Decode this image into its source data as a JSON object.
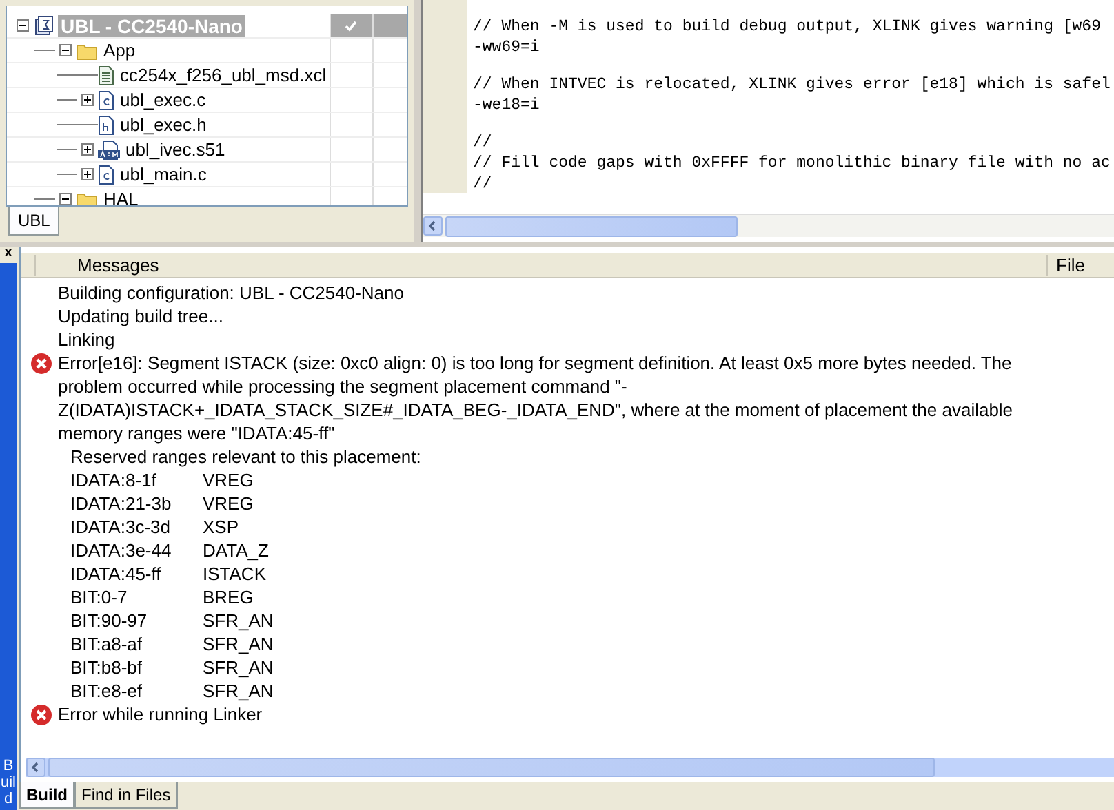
{
  "workspace": {
    "tree": [
      {
        "label": "UBL - CC2540-Nano",
        "kind": "project",
        "selected": true,
        "checked": true,
        "expanded": true,
        "children": [
          {
            "label": "App",
            "kind": "folder",
            "selected": false,
            "checked": false,
            "expanded": true,
            "children": [
              {
                "label": "cc254x_f256_ubl_msd.xcl",
                "kind": "text-file",
                "selected": false,
                "checked": false
              },
              {
                "label": "ubl_exec.c",
                "kind": "c-file",
                "selected": false,
                "checked": false,
                "expanded": false
              },
              {
                "label": "ubl_exec.h",
                "kind": "h-file",
                "selected": false,
                "checked": false
              },
              {
                "label": "ubl_ivec.s51",
                "kind": "asm-file",
                "selected": false,
                "checked": false,
                "expanded": false
              },
              {
                "label": "ubl_main.c",
                "kind": "c-file",
                "selected": false,
                "checked": false,
                "expanded": false
              }
            ]
          },
          {
            "label": "HAL",
            "kind": "folder",
            "selected": false,
            "checked": false,
            "expanded": true
          }
        ]
      }
    ],
    "tabs": [
      {
        "label": "UBL",
        "selected": true
      }
    ]
  },
  "editor": {
    "blocks": [
      [
        "// When -M is used to build debug output, XLINK gives warning [w69",
        "-ww69=i"
      ],
      [
        "// When INTVEC is relocated, XLINK gives error [e18] which is safel",
        "-we18=i"
      ],
      [
        "//",
        "// Fill code gaps with 0xFFFF for monolithic binary file with no ac",
        "//"
      ]
    ]
  },
  "build": {
    "side_label": "Build",
    "close": "x",
    "columns": [
      "Messages",
      "File"
    ],
    "messages": [
      {
        "kind": "info",
        "text": "Building configuration: UBL - CC2540-Nano"
      },
      {
        "kind": "info",
        "text": "Updating build tree..."
      },
      {
        "kind": "info",
        "text": "Linking"
      },
      {
        "kind": "error",
        "text": "Error[e16]: Segment ISTACK (size: 0xc0 align: 0) is too long for segment definition. At least 0x5 more bytes needed. The problem occurred while processing the segment placement command \"-Z(IDATA)ISTACK+_IDATA_STACK_SIZE#_IDATA_BEG-_IDATA_END\", where at the moment of placement the available memory ranges were \"IDATA:45-ff\""
      },
      {
        "kind": "detail",
        "text": "Reserved ranges relevant to this placement:"
      },
      {
        "kind": "range",
        "range": "IDATA:8-1f",
        "owner": "VREG"
      },
      {
        "kind": "range",
        "range": "IDATA:21-3b",
        "owner": "VREG"
      },
      {
        "kind": "range",
        "range": "IDATA:3c-3d",
        "owner": "XSP"
      },
      {
        "kind": "range",
        "range": "IDATA:3e-44",
        "owner": "DATA_Z"
      },
      {
        "kind": "range",
        "range": "IDATA:45-ff",
        "owner": "ISTACK"
      },
      {
        "kind": "range",
        "range": "BIT:0-7",
        "owner": "BREG"
      },
      {
        "kind": "range",
        "range": "BIT:90-97",
        "owner": "SFR_AN"
      },
      {
        "kind": "range",
        "range": "BIT:a8-af",
        "owner": "SFR_AN"
      },
      {
        "kind": "range",
        "range": "BIT:b8-bf",
        "owner": "SFR_AN"
      },
      {
        "kind": "range",
        "range": "BIT:e8-ef",
        "owner": "SFR_AN"
      },
      {
        "kind": "error",
        "text": "Error while running Linker"
      }
    ],
    "tabs": [
      {
        "label": "Build",
        "selected": true
      },
      {
        "label": "Find in Files",
        "selected": false
      }
    ]
  }
}
